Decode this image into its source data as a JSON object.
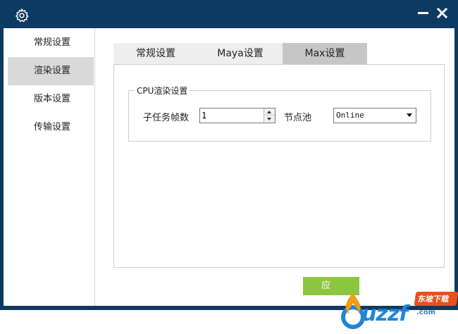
{
  "window": {
    "title_icon": "gear-icon",
    "min_icon": "minimize-icon",
    "close_icon": "close-icon"
  },
  "sidebar": {
    "items": [
      {
        "label": "常规设置"
      },
      {
        "label": "渲染设置"
      },
      {
        "label": "版本设置"
      },
      {
        "label": "传输设置"
      }
    ],
    "active_index": 1
  },
  "tabs": [
    {
      "label": "常规设置"
    },
    {
      "label": "Maya设置"
    },
    {
      "label": "Max设置"
    }
  ],
  "active_tab_index": 2,
  "cpu_group": {
    "legend": "CPU渲染设置",
    "subtask_frames_label": "子任务帧数",
    "subtask_frames_value": "1",
    "node_pool_label": "节点池",
    "node_pool_value": "Online"
  },
  "footer": {
    "apply_label": "应",
    "apply_color": "#8cc63f"
  },
  "watermark": {
    "brand": "uzzf",
    "tag": "东坡下载",
    "url": ".com"
  },
  "colors": {
    "titlebar": "#0d3a63",
    "active_nav": "#d9d9d9",
    "active_tab": "#c6c6c6"
  }
}
